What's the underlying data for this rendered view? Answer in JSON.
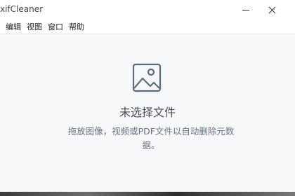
{
  "window": {
    "title": "xifCleaner"
  },
  "titlebar_buttons": {
    "minimize": "minimize",
    "close": "close"
  },
  "menu": {
    "items": [
      {
        "label": "编辑"
      },
      {
        "label": "视图"
      },
      {
        "label": "窗口"
      },
      {
        "label": "帮助"
      }
    ]
  },
  "empty_state": {
    "icon": "image-icon",
    "title": "未选择文件",
    "description": "拖放图像，视频或PDF文件以自动删除元数据。"
  },
  "colors": {
    "background": "#f7f8fa",
    "icon_stroke": "#5b6b7f",
    "title": "#4a4f57",
    "description": "#6b7280"
  }
}
